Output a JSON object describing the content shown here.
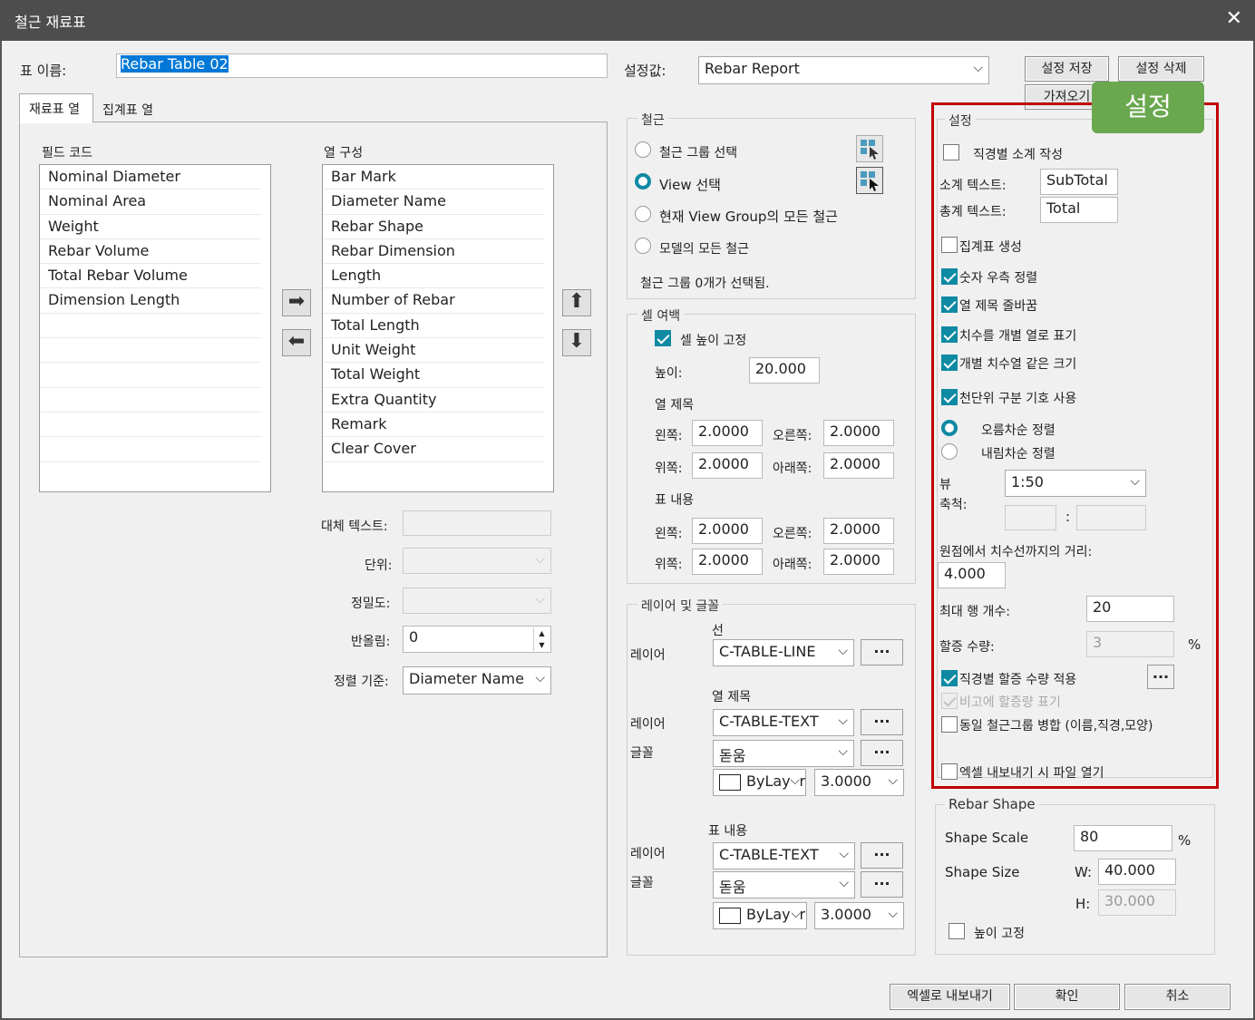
{
  "window": {
    "title": "철근 재료표",
    "close": "✕"
  },
  "table_name": {
    "label": "표 이름:",
    "value": "Rebar Table 02"
  },
  "preset": {
    "label": "설정값:",
    "value": "Rebar Report",
    "save": "설정 저장",
    "delete": "설정 삭제",
    "load": "가져오기"
  },
  "tabs": [
    "재료표 열",
    "집계표 열"
  ],
  "field_codes": {
    "label": "필드 코드",
    "items": [
      "Nominal Diameter",
      "Nominal Area",
      "Weight",
      "Rebar Volume",
      "Total Rebar Volume",
      "Dimension Length"
    ]
  },
  "columns": {
    "label": "열 구성",
    "items": [
      "Bar Mark",
      "Diameter Name",
      "Rebar Shape",
      "Rebar Dimension",
      "Length",
      "Number of Rebar",
      "Total Length",
      "Unit Weight",
      "Total Weight",
      "Extra Quantity",
      "Remark",
      "Clear Cover"
    ]
  },
  "props": {
    "alt_text": "대체 텍스트:",
    "unit": "단위:",
    "precision": "정밀도:",
    "rounding": "반올림:",
    "rounding_value": "0",
    "sort_by": "정렬 기준:",
    "sort_value": "Diameter Name"
  },
  "rebar": {
    "title": "철근",
    "opt1": "철근 그룹 선택",
    "opt2": "View 선택",
    "opt3": "현재 View Group의 모든 철근",
    "opt4": "모델의 모든 철근",
    "status": "철근 그룹 0개가 선택됨."
  },
  "cell_margin": {
    "title": "셀 여백",
    "fix_height": "셀 높이 고정",
    "height_label": "높이:",
    "height": "20.000",
    "col_title": "열 제목",
    "table_content": "표 내용",
    "left": "왼쪽:",
    "right": "오른쪽:",
    "top": "위쪽:",
    "bottom": "아래쪽:",
    "v": "2.0000"
  },
  "layer_font": {
    "title": "레이어 및 글꼴",
    "line": "선",
    "col_title": "열 제목",
    "content": "표 내용",
    "layer": "레이어",
    "font": "글꼴",
    "layer_line": "C-TABLE-LINE",
    "layer_text": "C-TABLE-TEXT",
    "font_name": "돋움",
    "color": "ByLayer",
    "size": "3.0000",
    "dots": "..."
  },
  "settings": {
    "badge": "설정",
    "title": "설정",
    "subtotal_by_dia": "직경별 소계 작성",
    "subtotal_text_label": "소계 텍스트:",
    "subtotal_text": "SubTotal",
    "total_text_label": "총계 텍스트:",
    "total_text": "Total",
    "make_summary": "집계표 생성",
    "num_right": "숫자 우측 정렬",
    "wrap_title": "열 제목 줄바꿈",
    "dim_sep": "치수를 개별 열로 표기",
    "same_width": "개별 치수열 같은 크기",
    "thousands": "천단위 구분 기호 사용",
    "asc": "오름차순 정렬",
    "desc": "내림차순 정렬",
    "view_scale_label": "뷰\n축척:",
    "view_scale": "1:50",
    "ratio_sep": ":",
    "dist_label": "원점에서 치수선까지의 거리:",
    "dist": "4.000",
    "max_rows_label": "최대 행 개수:",
    "max_rows": "20",
    "extra_label": "할증 수량:",
    "extra": "3",
    "pct": "%",
    "extra_by_dia": "직경별 할증 수량 적용",
    "extra_in_remark": "비고에 할증량 표기",
    "merge_same": "동일 철근그룹 병합 (이름,직경,모양)",
    "open_excel": "엑셀 내보내기 시 파일 열기"
  },
  "shape": {
    "title": "Rebar Shape",
    "scale_label": "Shape Scale",
    "scale": "80",
    "pct": "%",
    "size_label": "Shape Size",
    "w_label": "W:",
    "w": "40.000",
    "h_label": "H:",
    "h": "30.000",
    "fix_h": "높이 고정"
  },
  "footer": {
    "export": "엑셀로 내보내기",
    "ok": "확인",
    "cancel": "취소"
  },
  "colors": {
    "accent": "#0f8aa3",
    "highlight_box": "#c00000",
    "badge": "#6aa84f"
  }
}
